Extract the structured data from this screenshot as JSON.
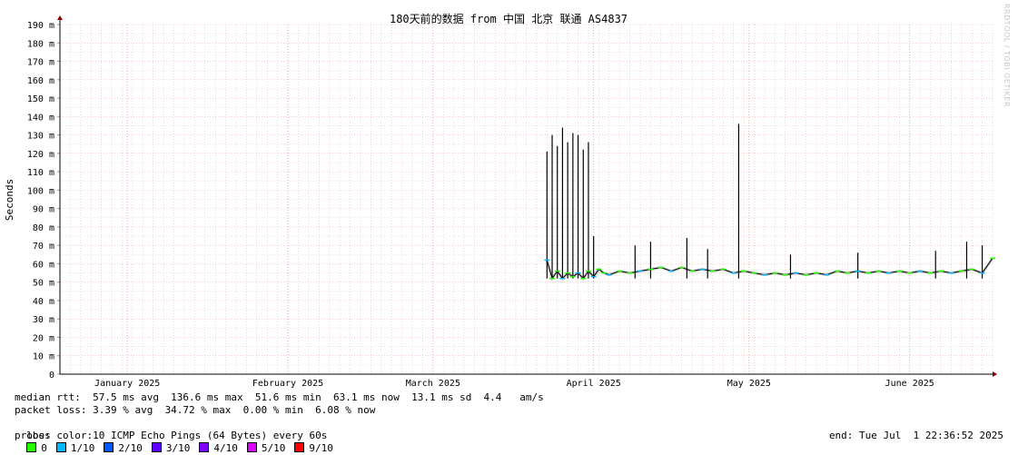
{
  "chart_data": {
    "type": "line",
    "title": "180天前的数据 from 中国 北京 联通 AS4837",
    "ylabel": "Seconds",
    "ylim": [
      0,
      190
    ],
    "y_ticks": [
      {
        "v": 0,
        "label": "0"
      },
      {
        "v": 10,
        "label": "10 m"
      },
      {
        "v": 20,
        "label": "20 m"
      },
      {
        "v": 30,
        "label": "30 m"
      },
      {
        "v": 40,
        "label": "40 m"
      },
      {
        "v": 50,
        "label": "50 m"
      },
      {
        "v": 60,
        "label": "60 m"
      },
      {
        "v": 70,
        "label": "70 m"
      },
      {
        "v": 80,
        "label": "80 m"
      },
      {
        "v": 90,
        "label": "90 m"
      },
      {
        "v": 100,
        "label": "100 m"
      },
      {
        "v": 110,
        "label": "110 m"
      },
      {
        "v": 120,
        "label": "120 m"
      },
      {
        "v": 130,
        "label": "130 m"
      },
      {
        "v": 140,
        "label": "140 m"
      },
      {
        "v": 150,
        "label": "150 m"
      },
      {
        "v": 160,
        "label": "160 m"
      },
      {
        "v": 170,
        "label": "170 m"
      },
      {
        "v": 180,
        "label": "180 m"
      },
      {
        "v": 190,
        "label": "190 m"
      }
    ],
    "x_range": [
      "2025-01-02",
      "2025-07-01"
    ],
    "x_ticks": [
      {
        "date": "2025-01-15",
        "label": "January 2025"
      },
      {
        "date": "2025-02-15",
        "label": "February 2025"
      },
      {
        "date": "2025-03-15",
        "label": "March 2025"
      },
      {
        "date": "2025-04-15",
        "label": "April 2025"
      },
      {
        "date": "2025-05-15",
        "label": "May 2025"
      },
      {
        "date": "2025-06-15",
        "label": "June 2025"
      }
    ],
    "grid": true,
    "series": [
      {
        "color": "#000000",
        "points": [
          {
            "x": "2025-04-06",
            "y": 62
          },
          {
            "x": "2025-04-07",
            "y": 52
          },
          {
            "x": "2025-04-08",
            "y": 56
          },
          {
            "x": "2025-04-09",
            "y": 52
          },
          {
            "x": "2025-04-10",
            "y": 55
          },
          {
            "x": "2025-04-11",
            "y": 53
          },
          {
            "x": "2025-04-12",
            "y": 55
          },
          {
            "x": "2025-04-13",
            "y": 52
          },
          {
            "x": "2025-04-14",
            "y": 56
          },
          {
            "x": "2025-04-15",
            "y": 53
          },
          {
            "x": "2025-04-16",
            "y": 57
          },
          {
            "x": "2025-04-17",
            "y": 55
          },
          {
            "x": "2025-04-18",
            "y": 54
          },
          {
            "x": "2025-04-20",
            "y": 56
          },
          {
            "x": "2025-04-22",
            "y": 55
          },
          {
            "x": "2025-04-24",
            "y": 56
          },
          {
            "x": "2025-04-26",
            "y": 57
          },
          {
            "x": "2025-04-28",
            "y": 58
          },
          {
            "x": "2025-04-30",
            "y": 56
          },
          {
            "x": "2025-05-02",
            "y": 58
          },
          {
            "x": "2025-05-04",
            "y": 56
          },
          {
            "x": "2025-05-06",
            "y": 57
          },
          {
            "x": "2025-05-08",
            "y": 56
          },
          {
            "x": "2025-05-10",
            "y": 57
          },
          {
            "x": "2025-05-12",
            "y": 55
          },
          {
            "x": "2025-05-14",
            "y": 56
          },
          {
            "x": "2025-05-16",
            "y": 55
          },
          {
            "x": "2025-05-18",
            "y": 54
          },
          {
            "x": "2025-05-20",
            "y": 55
          },
          {
            "x": "2025-05-22",
            "y": 54
          },
          {
            "x": "2025-05-24",
            "y": 55
          },
          {
            "x": "2025-05-26",
            "y": 54
          },
          {
            "x": "2025-05-28",
            "y": 55
          },
          {
            "x": "2025-05-30",
            "y": 54
          },
          {
            "x": "2025-06-01",
            "y": 56
          },
          {
            "x": "2025-06-03",
            "y": 55
          },
          {
            "x": "2025-06-05",
            "y": 56
          },
          {
            "x": "2025-06-07",
            "y": 55
          },
          {
            "x": "2025-06-09",
            "y": 56
          },
          {
            "x": "2025-06-11",
            "y": 55
          },
          {
            "x": "2025-06-13",
            "y": 56
          },
          {
            "x": "2025-06-15",
            "y": 55
          },
          {
            "x": "2025-06-17",
            "y": 56
          },
          {
            "x": "2025-06-19",
            "y": 55
          },
          {
            "x": "2025-06-21",
            "y": 56
          },
          {
            "x": "2025-06-23",
            "y": 55
          },
          {
            "x": "2025-06-25",
            "y": 56
          },
          {
            "x": "2025-06-27",
            "y": 57
          },
          {
            "x": "2025-06-29",
            "y": 55
          },
          {
            "x": "2025-07-01",
            "y": 63
          }
        ],
        "spikes": [
          {
            "x": "2025-04-06",
            "y": 121
          },
          {
            "x": "2025-04-07",
            "y": 130
          },
          {
            "x": "2025-04-08",
            "y": 124
          },
          {
            "x": "2025-04-09",
            "y": 134
          },
          {
            "x": "2025-04-10",
            "y": 126
          },
          {
            "x": "2025-04-11",
            "y": 131
          },
          {
            "x": "2025-04-12",
            "y": 130
          },
          {
            "x": "2025-04-13",
            "y": 122
          },
          {
            "x": "2025-04-14",
            "y": 126
          },
          {
            "x": "2025-04-15",
            "y": 75
          },
          {
            "x": "2025-04-23",
            "y": 70
          },
          {
            "x": "2025-04-26",
            "y": 72
          },
          {
            "x": "2025-05-03",
            "y": 74
          },
          {
            "x": "2025-05-07",
            "y": 68
          },
          {
            "x": "2025-05-13",
            "y": 136
          },
          {
            "x": "2025-05-23",
            "y": 65
          },
          {
            "x": "2025-06-05",
            "y": 66
          },
          {
            "x": "2025-06-20",
            "y": 67
          },
          {
            "x": "2025-06-26",
            "y": 72
          },
          {
            "x": "2025-06-29",
            "y": 70
          }
        ]
      }
    ]
  },
  "stats": {
    "median_rtt": "median rtt:  57.5 ms avg  136.6 ms max  51.6 ms min  63.1 ms now  13.1 ms sd  4.4   am/s",
    "packet_loss": "packet loss: 3.39 % avg  34.72 % max  0.00 % min  6.08 % now",
    "loss_color_label": "loss color:",
    "loss_colors": [
      {
        "label": "0",
        "color": "#26ff00"
      },
      {
        "label": "1/10",
        "color": "#00b8ff"
      },
      {
        "label": "2/10",
        "color": "#0059ff"
      },
      {
        "label": "3/10",
        "color": "#5e00ff"
      },
      {
        "label": "4/10",
        "color": "#7e00ff"
      },
      {
        "label": "5/10",
        "color": "#dd00ff"
      },
      {
        "label": "9/10",
        "color": "#ff0000"
      }
    ],
    "probe": "probe:       10 ICMP Echo Pings (64 Bytes) every 60s",
    "end": "end: Tue Jul  1 22:36:52 2025"
  },
  "watermark": "RRDTOOL / TOBI OETIKER"
}
